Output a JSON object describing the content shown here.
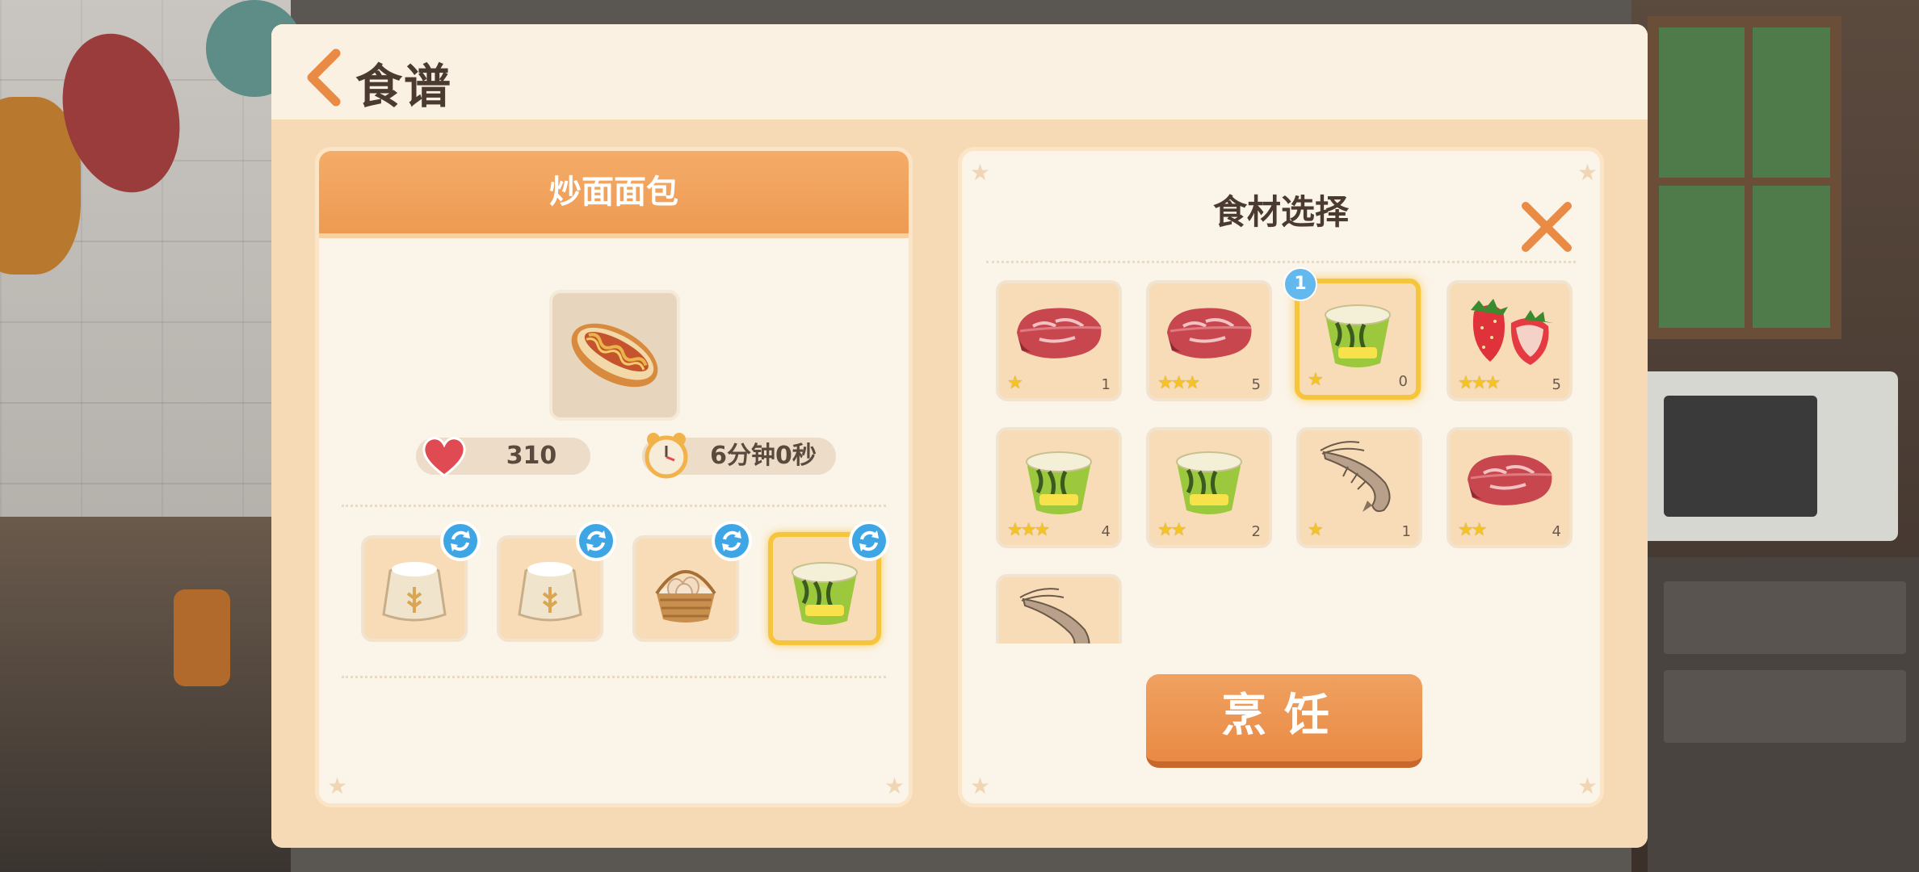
{
  "header": {
    "title": "食谱"
  },
  "recipe": {
    "name": "炒面面包",
    "affection": "310",
    "time": "6分钟0秒",
    "ingredients": [
      {
        "name": "flour-sack"
      },
      {
        "name": "flour-sack"
      },
      {
        "name": "egg-basket"
      },
      {
        "name": "cup-noodle",
        "selected": true
      }
    ]
  },
  "selection": {
    "title": "食材选择",
    "cook_label": "烹饪",
    "selected_badge": "1",
    "items": [
      {
        "icon": "meat",
        "stars": "★",
        "count": "1"
      },
      {
        "icon": "meat",
        "stars": "★★★",
        "count": "5"
      },
      {
        "icon": "cup-noodle",
        "stars": "★",
        "count": "0",
        "selected": true
      },
      {
        "icon": "strawberry",
        "stars": "★★★",
        "count": "5"
      },
      {
        "icon": "cup-noodle",
        "stars": "★★★",
        "count": "4"
      },
      {
        "icon": "cup-noodle",
        "stars": "★★",
        "count": "2"
      },
      {
        "icon": "shrimp",
        "stars": "★",
        "count": "1"
      },
      {
        "icon": "meat",
        "stars": "★★",
        "count": "4"
      },
      {
        "icon": "shrimp",
        "stars": "",
        "count": ""
      }
    ]
  },
  "colors": {
    "accent": "#ee9a52",
    "panel": "#fbeedd",
    "badge": "#3fa6e6",
    "star": "#f5c326"
  }
}
